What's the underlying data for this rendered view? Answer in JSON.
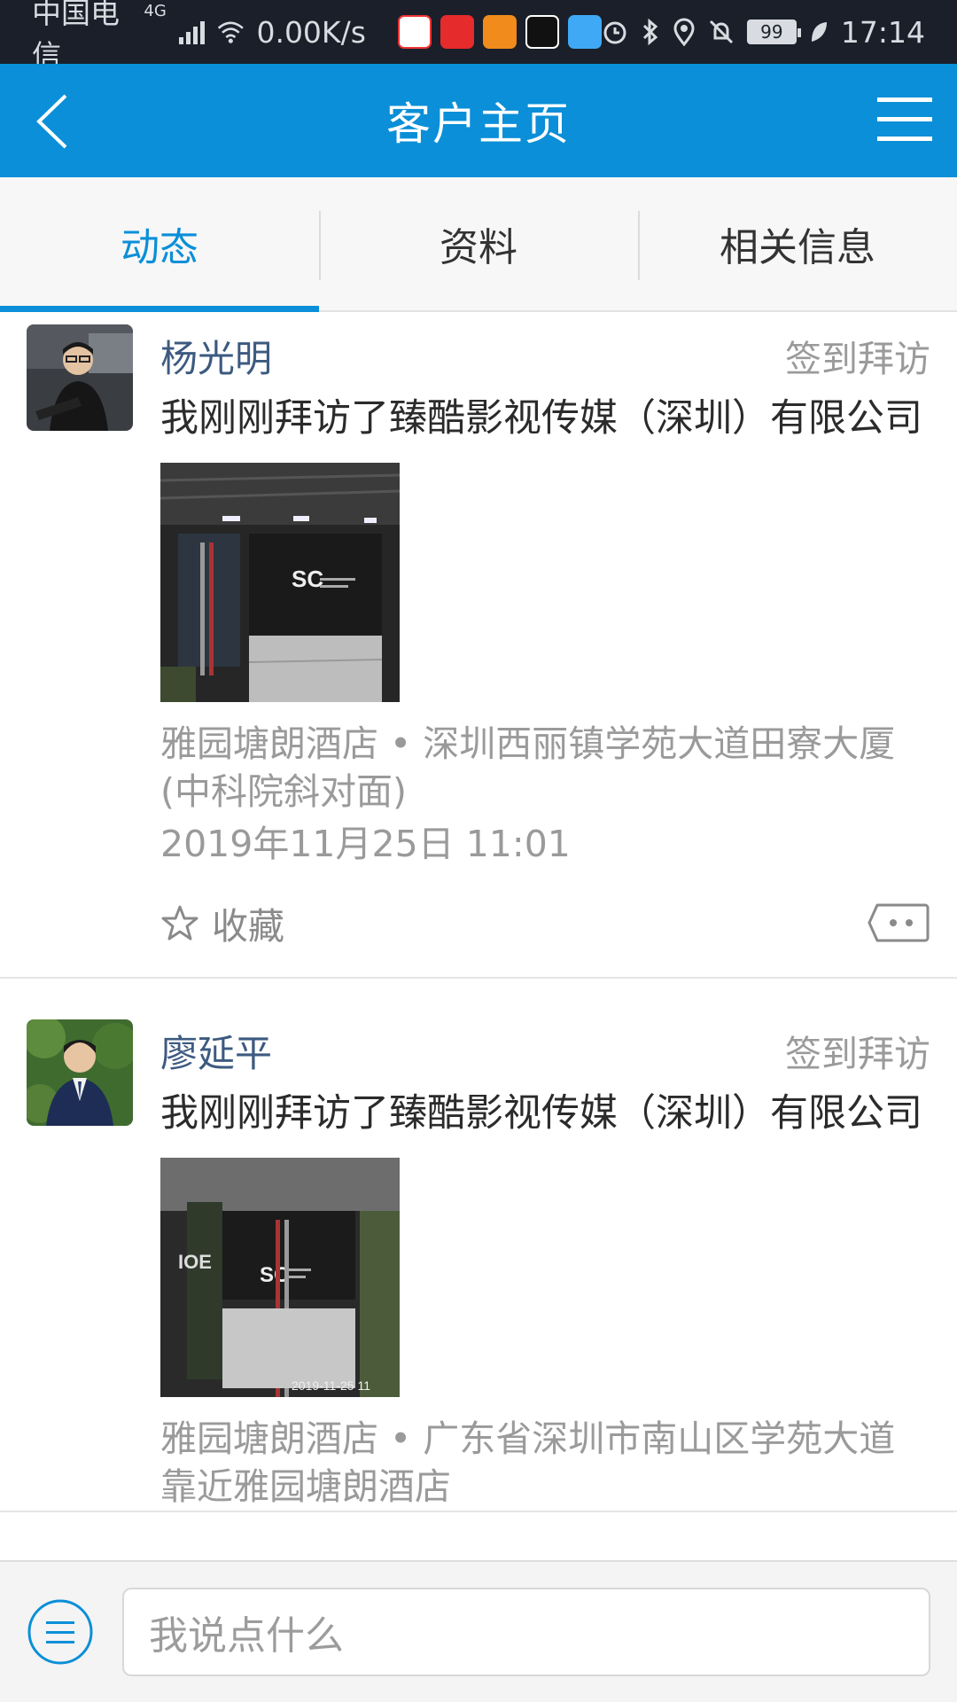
{
  "status_bar": {
    "carrier": "中国电信",
    "network": "4G",
    "speed": "0.00K/s",
    "battery": "99",
    "time": "17:14"
  },
  "header": {
    "title": "客户主页",
    "back_icon": "chevron-left-icon",
    "menu_icon": "hamburger-menu-icon"
  },
  "tabs": [
    {
      "label": "动态",
      "active": true
    },
    {
      "label": "资料",
      "active": false
    },
    {
      "label": "相关信息",
      "active": false
    }
  ],
  "posts": [
    {
      "author": "杨光明",
      "type": "签到拜访",
      "text": "我刚刚拜访了臻酷影视传媒（深圳）有限公司",
      "location": "雅园塘朗酒店 • 深圳西丽镇学苑大道田寮大厦(中科院斜对面)",
      "time": "2019年11月25日 11:01",
      "favorite_label": "收藏"
    },
    {
      "author": "廖延平",
      "type": "签到拜访",
      "text": "我刚刚拜访了臻酷影视传媒（深圳）有限公司",
      "location": "雅园塘朗酒店 • 广东省深圳市南山区学苑大道靠近雅园塘朗酒店",
      "photo_stamp": "2019-11-25 11",
      "time": "",
      "favorite_label": "收藏"
    }
  ],
  "bottom_bar": {
    "input_placeholder": "我说点什么"
  },
  "colors": {
    "primary": "#0a8fd8",
    "status_bar": "#1a1f2a"
  }
}
